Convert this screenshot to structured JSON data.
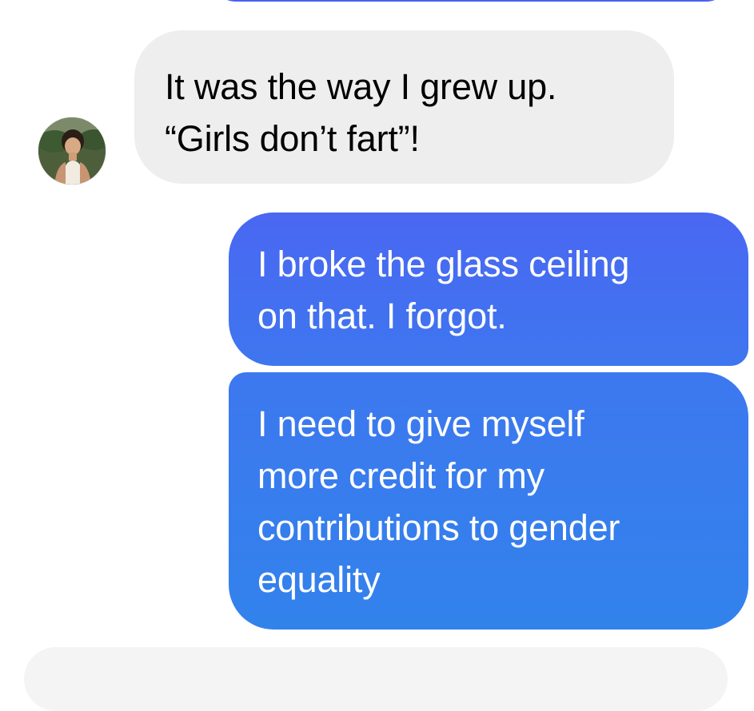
{
  "conversation": {
    "messages": [
      {
        "direction": "incoming",
        "text": "It was the way I grew up.\n“Girls don’t fart”!"
      },
      {
        "direction": "outgoing",
        "text": "I broke the glass ceiling\non that. I forgot."
      },
      {
        "direction": "outgoing",
        "text": "I need to give myself\nmore credit for my\ncontributions to gender\nequality"
      }
    ]
  },
  "colors": {
    "incoming_bubble": "#eeeeee",
    "outgoing_bubble_top": "#4a67f2",
    "outgoing_bubble_bottom": "#3282ec",
    "incoming_text": "#000000",
    "outgoing_text": "#ffffff"
  },
  "icons": {
    "avatar": "contact-avatar-photo"
  }
}
